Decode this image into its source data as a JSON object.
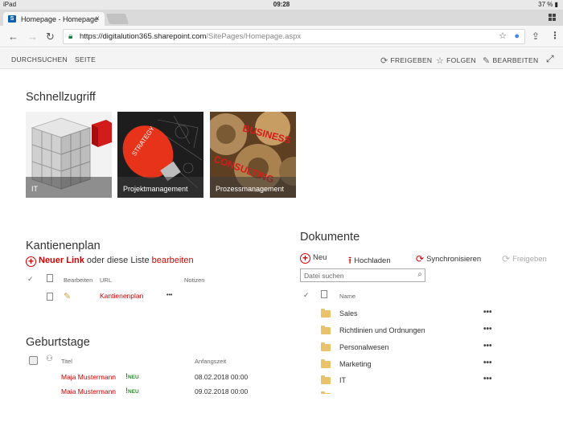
{
  "status": {
    "device": "iPad",
    "time": "09:28",
    "battery": "37 %"
  },
  "tab": {
    "title": "Homepage - Homepage",
    "close": "×"
  },
  "address": {
    "host": "https://digitalution365.sharepoint.com",
    "path": "/SitePages/Homepage.aspx"
  },
  "commandbar": {
    "browse": "DURCHSUCHEN",
    "page": "SEITE",
    "share": "FREIGEBEN",
    "follow": "FOLGEN",
    "edit": "BEARBEITEN"
  },
  "quick": {
    "heading": "Schnellzugriff",
    "tiles": [
      {
        "label": "IT"
      },
      {
        "label": "Projektmanagement"
      },
      {
        "label": "Prozessmanagement"
      }
    ]
  },
  "kantine": {
    "heading": "Kantienenplan",
    "new_link": "Neuer Link",
    "or_text": "oder diese Liste",
    "edit_link": "bearbeiten",
    "col_edit": "Bearbeiten",
    "col_url": "URL",
    "col_notes": "Notizen",
    "row_url": "Kantienenplan",
    "row_menu": "•••"
  },
  "birthdays": {
    "heading": "Geburtstage",
    "col_title": "Titel",
    "col_start": "Anfangszeit",
    "badge": "NEU",
    "rows": [
      {
        "name": "Maja Mustermann",
        "date": "08.02.2018 00:00"
      },
      {
        "name": "Maja Mustermann",
        "date": "09.02.2018 00:00"
      }
    ]
  },
  "documents": {
    "heading": "Dokumente",
    "new": "Neu",
    "upload": "Hochladen",
    "sync": "Synchronisieren",
    "share": "Freigeben",
    "search_placeholder": "Datei suchen",
    "col_name": "Name",
    "menu": "•••",
    "rows": [
      {
        "name": "Sales"
      },
      {
        "name": "Richtlinien und Ordnungen"
      },
      {
        "name": "Personalwesen"
      },
      {
        "name": "Marketing"
      },
      {
        "name": "IT"
      }
    ]
  },
  "colors": {
    "accent": "#d40000",
    "folder": "#e8c36b",
    "new_badge": "#2c8a2c"
  }
}
